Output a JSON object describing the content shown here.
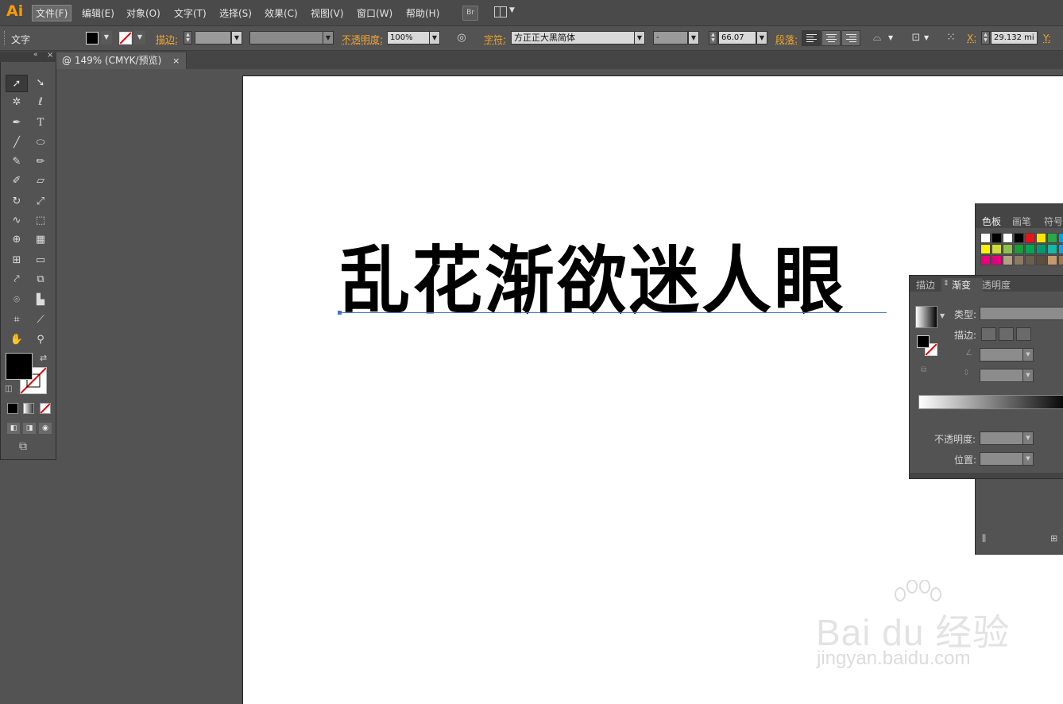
{
  "app": {
    "logo": "Ai",
    "accent_color": "#ff9a00"
  },
  "menu": {
    "items": [
      "文件(F)",
      "编辑(E)",
      "对象(O)",
      "文字(T)",
      "选择(S)",
      "效果(C)",
      "视图(V)",
      "窗口(W)",
      "帮助(H)"
    ],
    "bridge_label": "Br"
  },
  "control_bar": {
    "mode_label": "文字",
    "stroke_label": "描边:",
    "opacity_label": "不透明度:",
    "opacity_value": "100%",
    "char_label": "字符:",
    "font_family": "方正正大黑简体",
    "font_style": "-",
    "font_size": "66.07",
    "paragraph_label": "段落:",
    "x_label": "X:",
    "x_value": "29.132 mi",
    "y_label": "Y:"
  },
  "document": {
    "tab_title": "@ 149% (CMYK/预览)",
    "close_glyph": "×"
  },
  "canvas": {
    "headline": "乱花渐欲迷人眼"
  },
  "swatches_panel": {
    "tabs": [
      "色板",
      "画笔",
      "符号"
    ],
    "colors": [
      "#ffffff",
      "#000000",
      "#ffffff",
      "#000000",
      "#e8141b",
      "#ffe500",
      "#2da646",
      "#00a2e8",
      "#fff200",
      "#cddc39",
      "#8bc34a",
      "#1a9c3a",
      "#00a651",
      "#009a6e",
      "#15b9a5",
      "#1ba1e2",
      "#e6007e",
      "#e4007f",
      "#b6a081",
      "#8c7a64",
      "#6b5e4e",
      "#5c4d3c",
      "#c49a6c",
      "#a0784a"
    ]
  },
  "gradient_panel": {
    "tabs": [
      "描边",
      "渐变",
      "透明度"
    ],
    "type_label": "类型:",
    "stroke_label": "描边:",
    "opacity_label": "不透明度:",
    "location_label": "位置:"
  },
  "watermark": {
    "brand": "Bai du 经验",
    "url": "jingyan.baidu.com"
  }
}
